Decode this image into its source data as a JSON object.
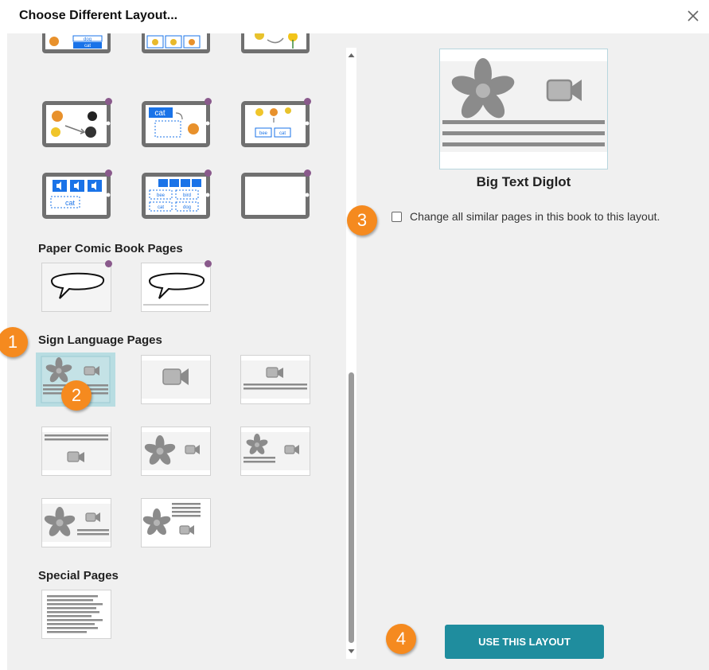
{
  "dialog": {
    "title": "Choose Different Layout...",
    "close_icon": "close-icon"
  },
  "sections": {
    "paper_comic": "Paper Comic Book Pages",
    "sign_language": "Sign Language Pages",
    "special": "Special Pages"
  },
  "thumbnail_text": {
    "dog": "dog",
    "cat": "cat",
    "bee": "bee",
    "bird": "bird"
  },
  "preview": {
    "layout_name": "Big Text Diglot",
    "checkbox_label": "Change all similar pages in this book to this layout.",
    "checkbox_checked": false
  },
  "actions": {
    "use_layout": "USE THIS LAYOUT"
  },
  "callouts": [
    "1",
    "2",
    "3",
    "4"
  ],
  "colors": {
    "accent": "#1f8d9e",
    "callout": "#f58a1f",
    "selected": "#b8dde2",
    "tablet_frame": "#707070",
    "premium_dot": "#8a5a8c",
    "word_box": "#1a73e8"
  }
}
